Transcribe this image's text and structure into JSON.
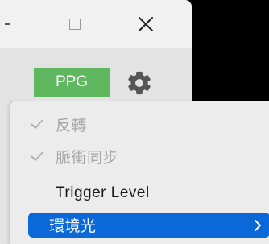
{
  "titlebar": {
    "minimize_icon": "minimize-icon",
    "maximize_icon": "maximize-icon",
    "close_icon": "close-icon"
  },
  "toolbar": {
    "ppg_label": "PPG",
    "ppg_color": "#5fb760",
    "settings_icon": "gear-icon"
  },
  "menu": {
    "items": [
      {
        "label": "反轉",
        "checked": true,
        "disabled": true
      },
      {
        "label": "脈衝同步",
        "checked": true,
        "disabled": true
      },
      {
        "label": "Trigger Level",
        "checked": false,
        "disabled": false
      },
      {
        "label": "環境光",
        "checked": false,
        "disabled": false,
        "highlighted": true,
        "has_submenu": true
      }
    ],
    "highlight_color": "#0a68d8"
  }
}
